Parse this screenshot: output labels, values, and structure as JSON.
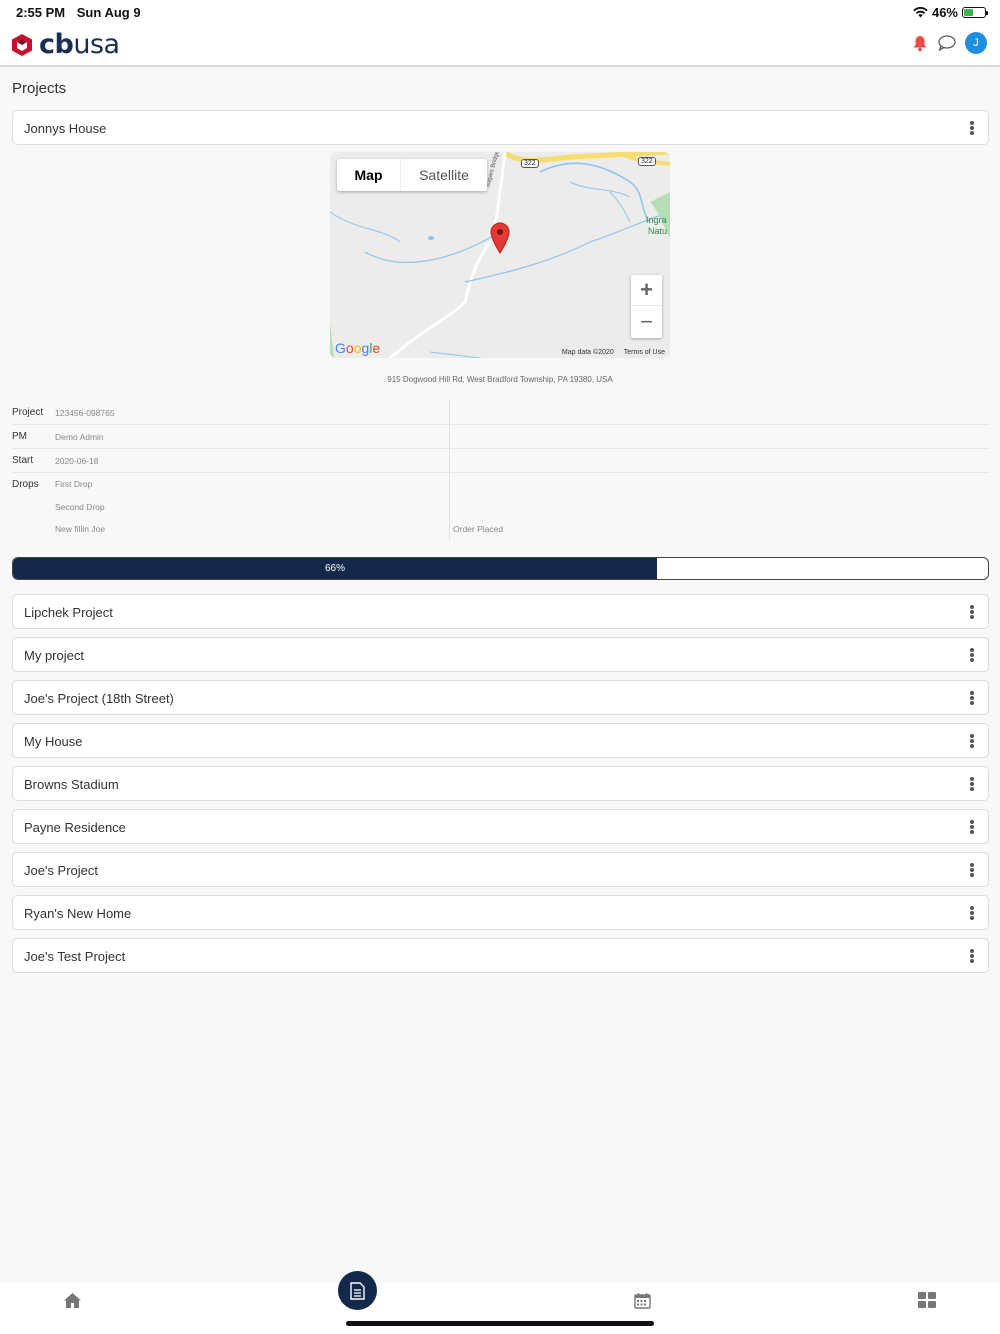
{
  "status": {
    "time": "2:55 PM",
    "date": "Sun Aug 9",
    "battery": "46%",
    "battery_level": 0.46
  },
  "brand": {
    "logo_text_bold": "cb",
    "logo_text": "usa"
  },
  "header": {
    "avatar_initial": "J",
    "icons": [
      "bell-icon",
      "chat-icon"
    ]
  },
  "page": {
    "title": "Projects"
  },
  "expanded_project": {
    "name": "Jonnys House",
    "map": {
      "toggle_map": "Map",
      "toggle_satellite": "Satellite",
      "zoom_in": "+",
      "zoom_out": "−",
      "google": "Google",
      "map_data": "Map data ©2020",
      "terms": "Terms of Use",
      "road_label": "Sugars Bridge Rd",
      "route_a": "322",
      "route_b": "322",
      "poi_line1": "Ingra",
      "poi_line2": "Natu"
    },
    "address": "915 Dogwood Hill Rd, West Bradford Township, PA 19380, USA",
    "details": {
      "project_label": "Project",
      "project_value": "123456-098765",
      "pm_label": "PM",
      "pm_value": "Demo Admin",
      "start_label": "Start",
      "start_value": "2020-06-18",
      "drops_label": "Drops",
      "drops": [
        "First Drop",
        "Second Drop",
        "New fillin Joe"
      ],
      "drop_status": "Order Placed"
    },
    "progress": {
      "label": "66%",
      "value": 0.66
    }
  },
  "projects": [
    "Lipchek Project",
    "My project",
    "Joe's Project (18th Street)",
    "My House",
    "Browns Stadium",
    "Payne Residence",
    "Joe's Project",
    "Ryan's New Home",
    "Joe's Test Project"
  ],
  "bottom_nav": [
    "home-icon",
    "document-icon",
    "calendar-icon",
    "grid-icon"
  ]
}
